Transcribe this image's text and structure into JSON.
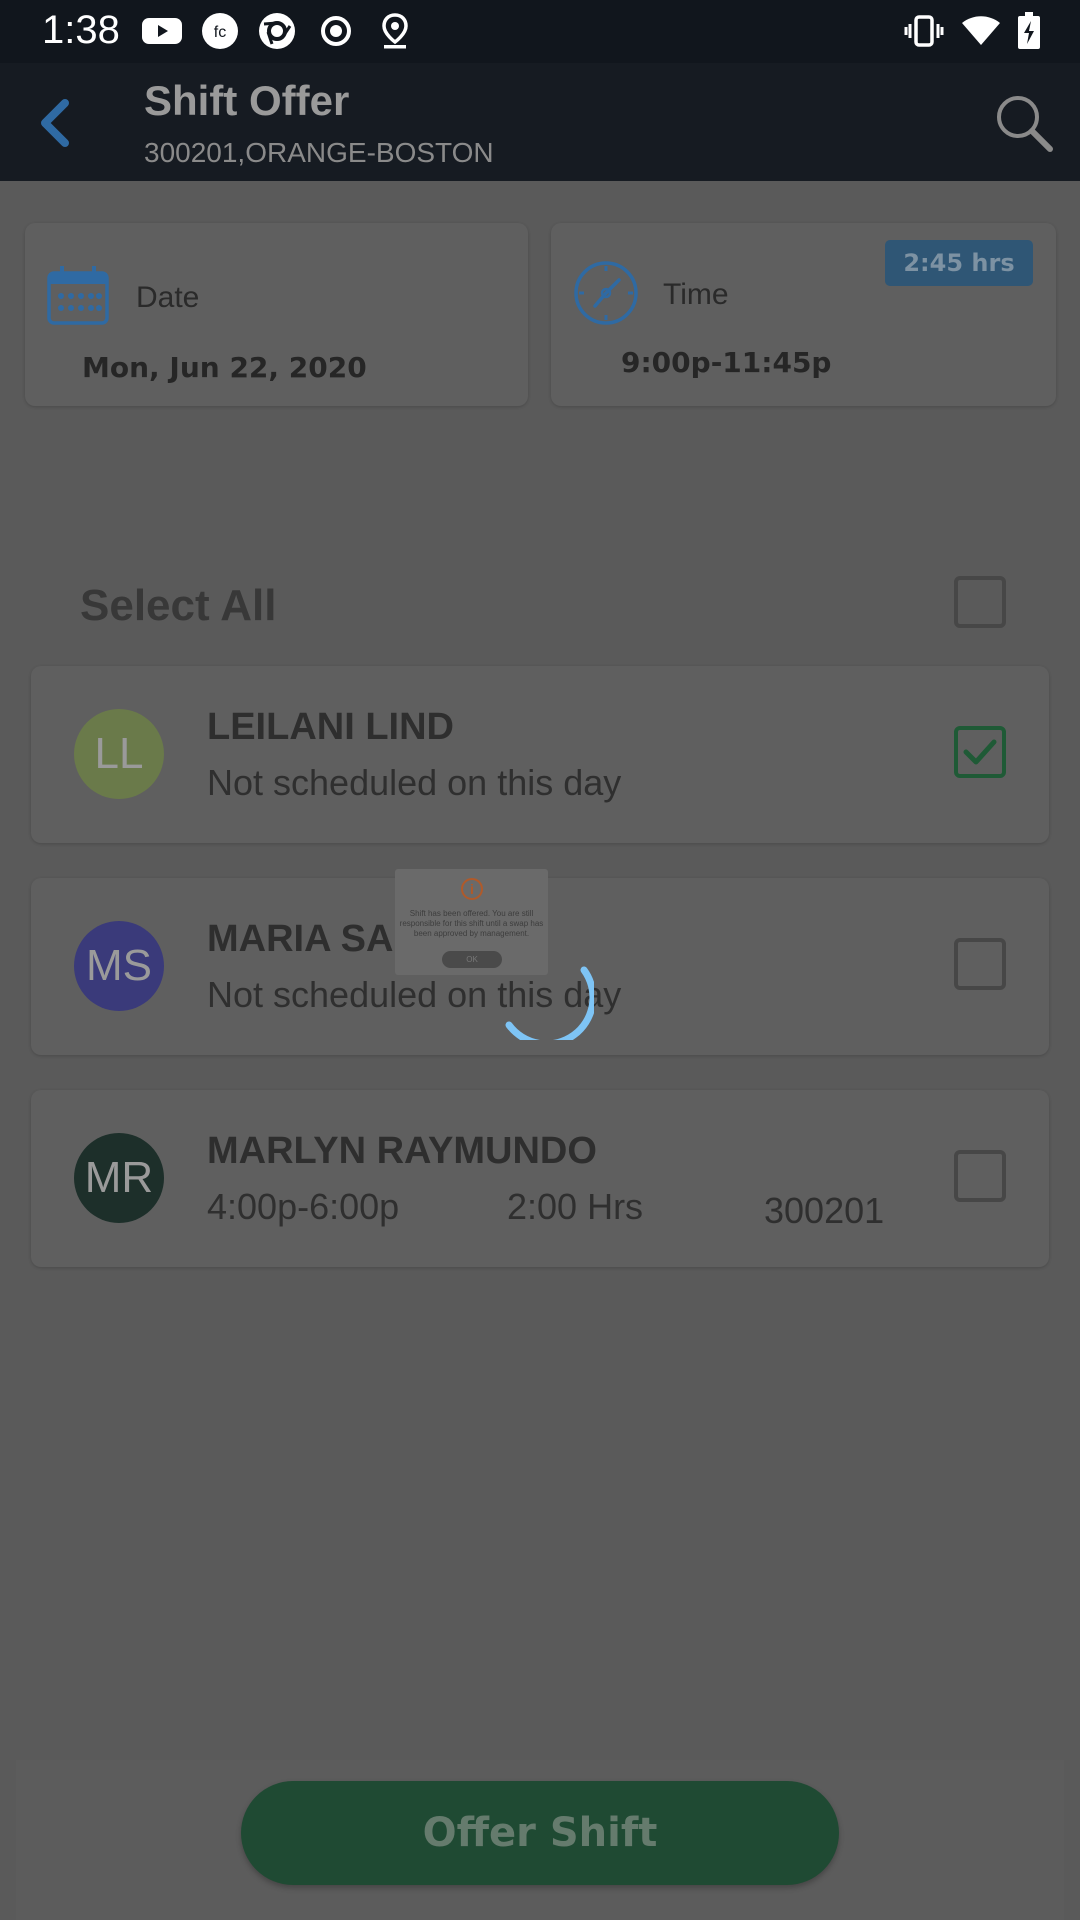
{
  "status_bar": {
    "time": "1:38",
    "left_icons": [
      "youtube-icon",
      "fc-app-icon",
      "camera-shutter-icon",
      "record-icon",
      "location-pin-icon"
    ],
    "right_icons": [
      "vibrate-icon",
      "wifi-icon",
      "battery-charging-icon"
    ]
  },
  "app_bar": {
    "title": "Shift Offer",
    "subtitle": "300201,ORANGE-BOSTON",
    "accent_color": "#2f6aa3"
  },
  "date_card": {
    "label": "Date",
    "value": "Mon, Jun 22, 2020",
    "icon": "calendar-icon"
  },
  "time_card": {
    "label": "Time",
    "value": "9:00p-11:45p",
    "badge": "2:45 hrs",
    "icon": "clock-icon"
  },
  "select_all": {
    "label": "Select All",
    "checked": false
  },
  "people": [
    {
      "initials": "LL",
      "name": "LEILANI LIND",
      "subtitle": "Not scheduled on this day",
      "avatar_color": "#6a7a4a",
      "checked": true
    },
    {
      "initials": "MS",
      "name": "MARIA SALGADO",
      "subtitle": "Not scheduled on this day",
      "avatar_color": "#3a3a7a",
      "checked": false
    },
    {
      "initials": "MR",
      "name": "MARLYN RAYMUNDO",
      "time": "4:00p-6:00p",
      "hours": "2:00 Hrs",
      "unit": "300201",
      "avatar_color": "#1d2f2a",
      "checked": false
    }
  ],
  "dialog": {
    "message": "Shift has been offered. You are still responsible for this shift until a swap has been approved by management.",
    "ok_label": "OK"
  },
  "footer": {
    "offer_button": "Offer Shift"
  }
}
